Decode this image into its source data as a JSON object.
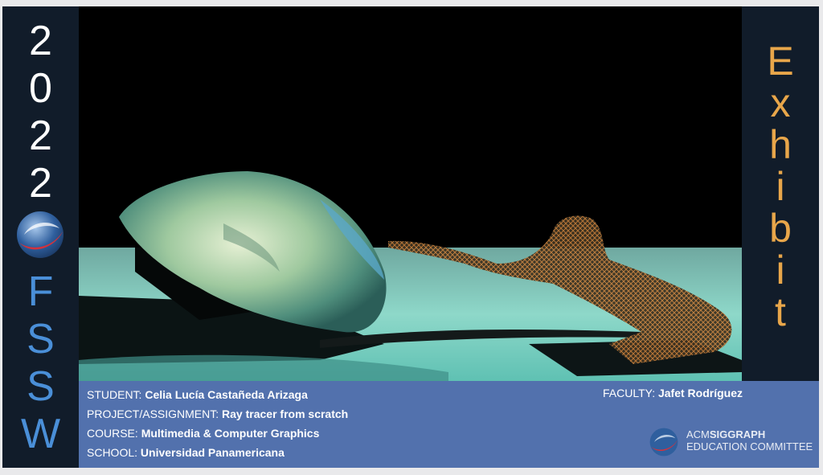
{
  "left_bar": {
    "year_digits": [
      "2",
      "0",
      "2",
      "2"
    ],
    "program_letters": [
      "F",
      "S",
      "S",
      "W"
    ]
  },
  "right_bar": {
    "letters": [
      "E",
      "x",
      "h",
      "i",
      "b",
      "i",
      "t"
    ]
  },
  "credits": {
    "student_label": "STUDENT:",
    "student_value": "Celia Lucía Castañeda Arizaga",
    "project_label": "PROJECT/ASSIGNMENT:",
    "project_value": "Ray tracer from scratch",
    "course_label": "COURSE:",
    "course_value": "Multimedia & Computer Graphics",
    "school_label": "SCHOOL:",
    "school_value": "Universidad Panamericana",
    "faculty_label": "FACULTY:",
    "faculty_value": "Jafet Rodríguez"
  },
  "acm_logo": {
    "line1_prefix": "ACM",
    "line1_bold": "SIGGRAPH",
    "line2": "EDUCATION COMMITTEE"
  },
  "colors": {
    "year": "#ffffff",
    "program": "#4a8fd8",
    "exhibit": "#e8a64a",
    "info_bar": "#5271ad",
    "sidebar": "#111c2a"
  }
}
